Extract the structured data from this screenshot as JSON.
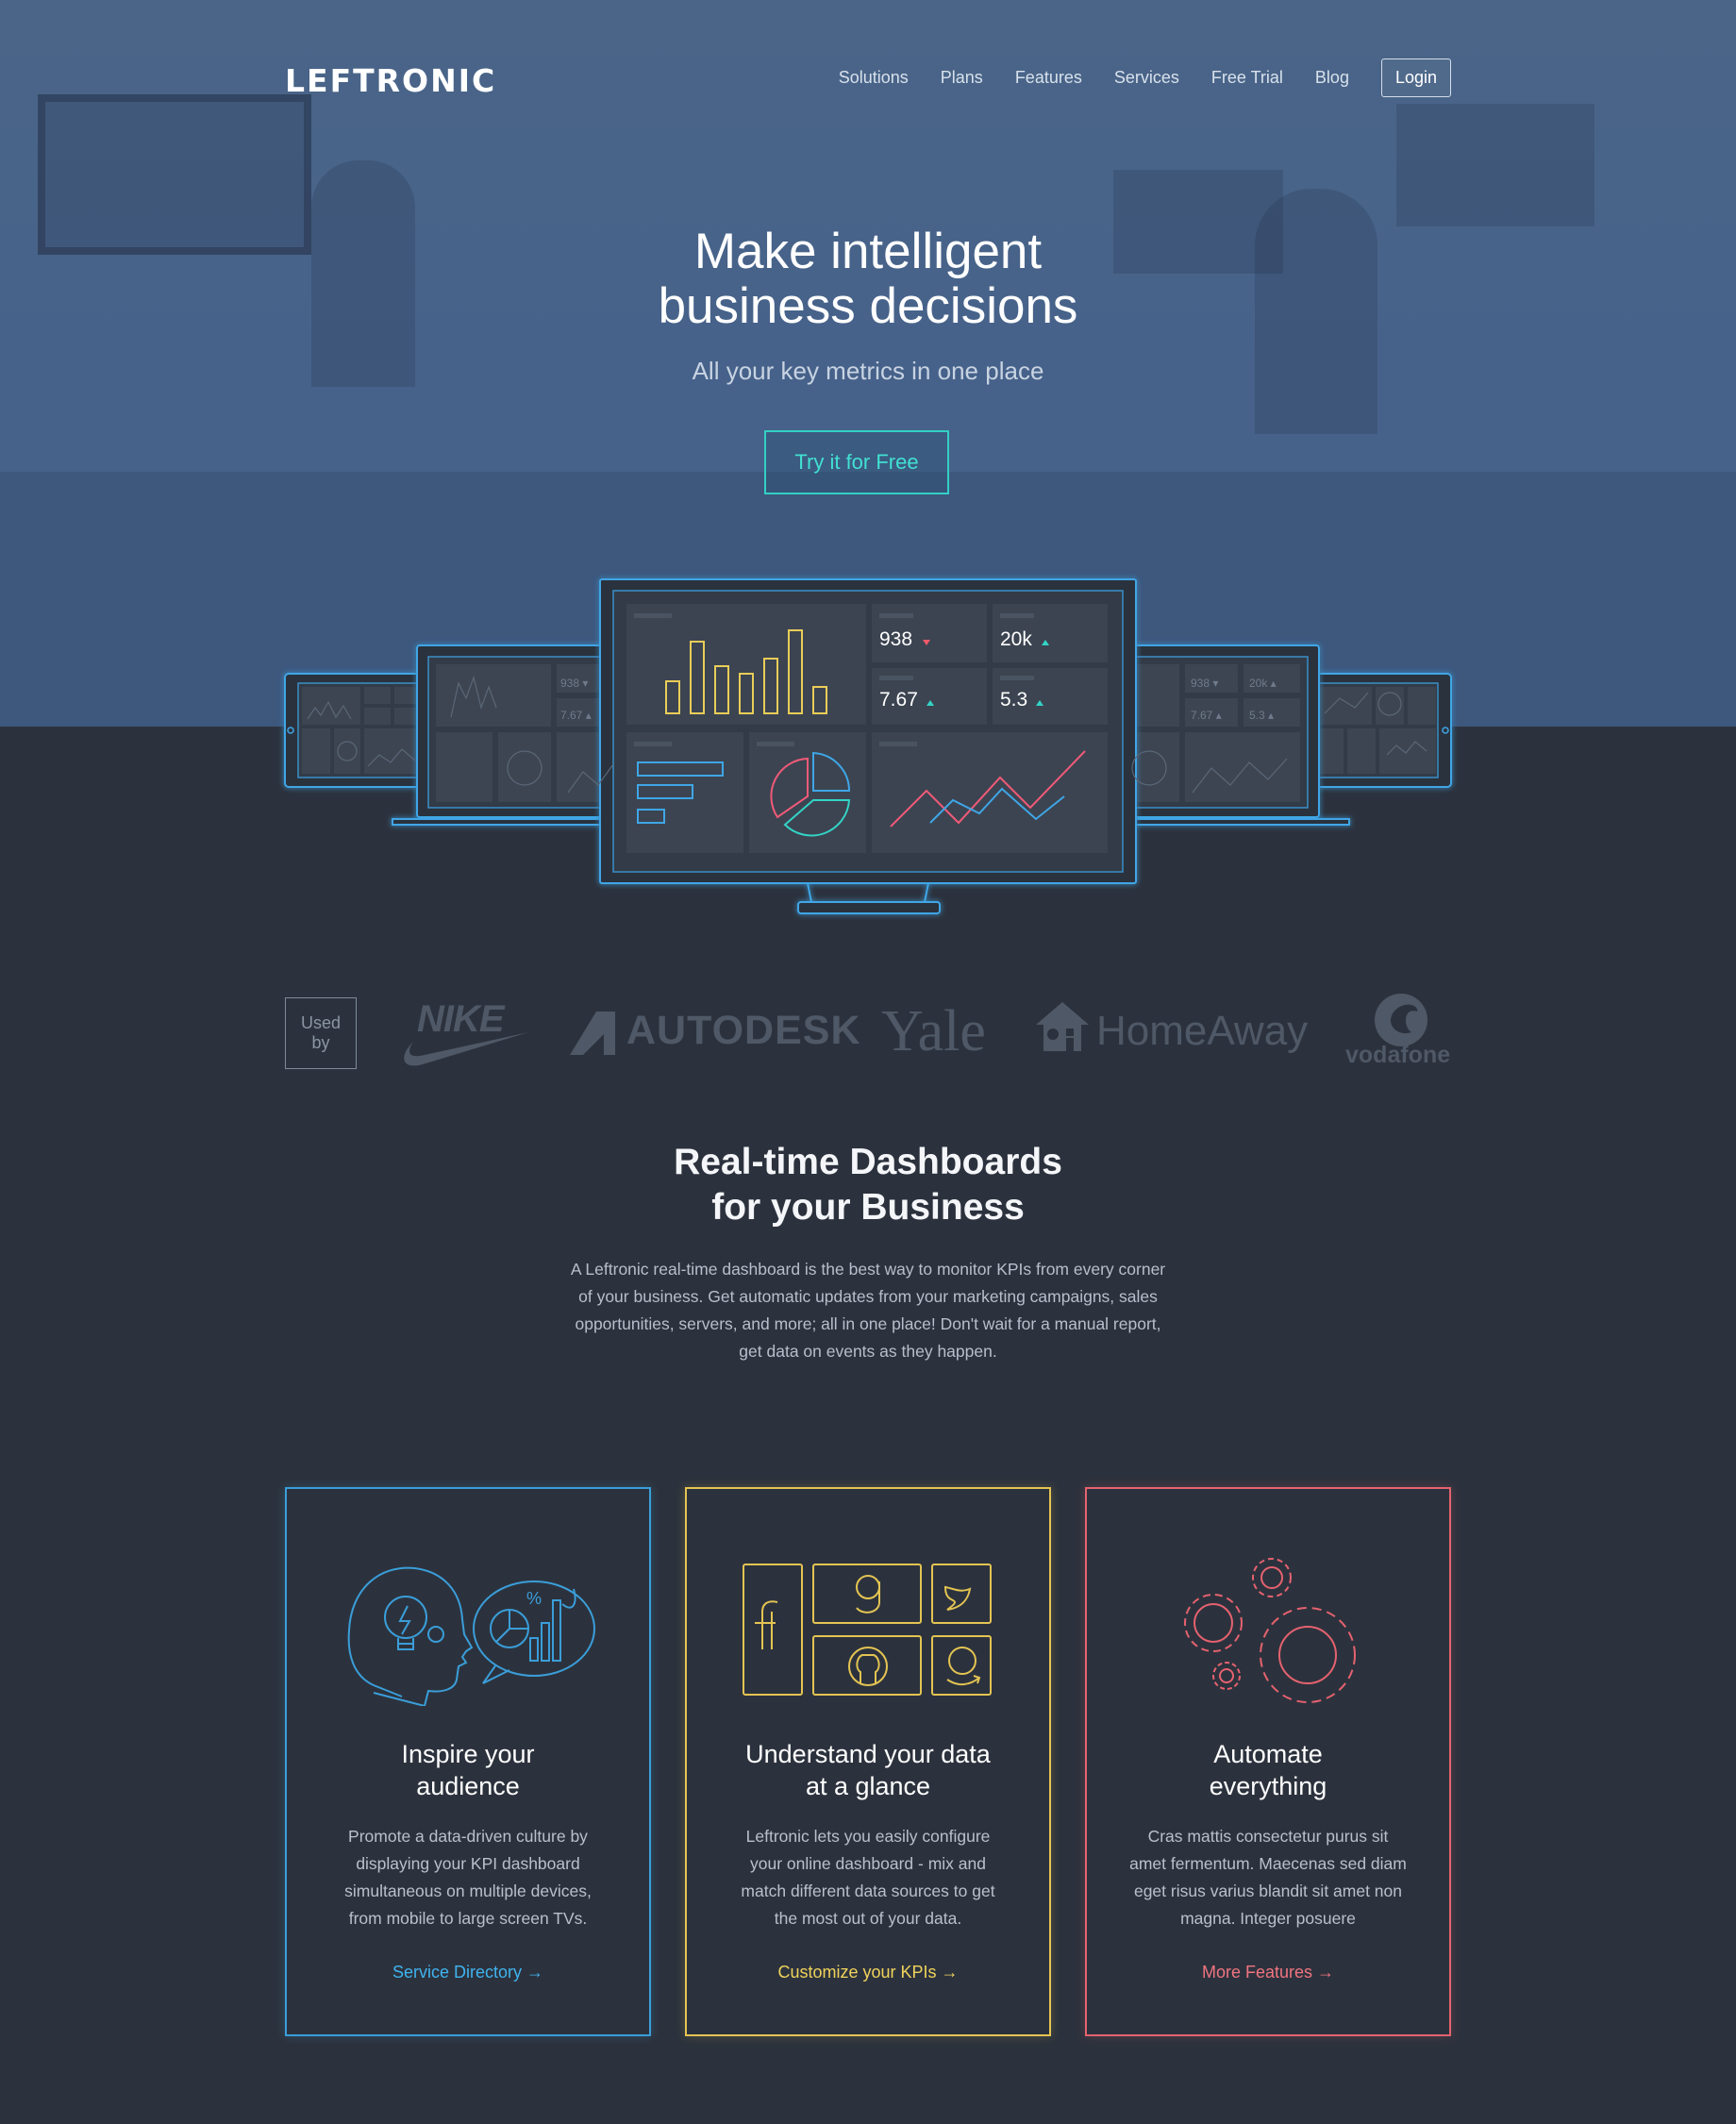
{
  "header": {
    "logo": "LEFTRONIC",
    "nav": [
      "Solutions",
      "Plans",
      "Features",
      "Services",
      "Free Trial",
      "Blog"
    ],
    "login_label": "Login"
  },
  "hero": {
    "title_line1": "Make intelligent",
    "title_line2": "business decisions",
    "subtitle": "All your key metrics in one place",
    "cta_label": "Try it for Free"
  },
  "dashboard": {
    "metrics": [
      {
        "value": "938",
        "trend": "down",
        "trend_color": "#f05a68"
      },
      {
        "value": "20k",
        "trend": "up",
        "trend_color": "#33d4c6"
      },
      {
        "value": "7.67",
        "trend": "up",
        "trend_color": "#33d4c6"
      },
      {
        "value": "5.3",
        "trend": "up",
        "trend_color": "#33d4c6"
      }
    ]
  },
  "clients": {
    "label_line1": "Used",
    "label_line2": "by",
    "brands": [
      "NIKE",
      "AUTODESK",
      "Yale",
      "HomeAway",
      "vodafone"
    ]
  },
  "intro": {
    "title_line1": "Real-time Dashboards",
    "title_line2": "for your Business",
    "text": "A Leftronic real-time dashboard is the best way to monitor KPIs from every corner of your business. Get automatic updates from your marketing campaigns, sales opportunities, servers, and more; all in one place! Don't wait for a manual report, get data on events as they happen."
  },
  "cards": [
    {
      "title_line1": "Inspire your",
      "title_line2": "audience",
      "text": "Promote a data-driven culture by displaying your KPI dashboard simultaneous on multiple devices, from mobile to large screen TVs.",
      "link": "Service Directory →",
      "color": "#3a9ed9"
    },
    {
      "title_line1": "Understand your data",
      "title_line2": "at a glance",
      "text": "Leftronic lets you easily configure your online dashboard - mix and match different data sources to get the most out of your data.",
      "link": "Customize your KPIs →",
      "color": "#e3c453"
    },
    {
      "title_line1": "Automate",
      "title_line2": "everything",
      "text": "Cras mattis consectetur purus sit amet fermentum. Maecenas sed diam eget risus varius blandit sit amet non magna. Integer posuere",
      "link": "More Features →",
      "color": "#e5626f"
    }
  ]
}
